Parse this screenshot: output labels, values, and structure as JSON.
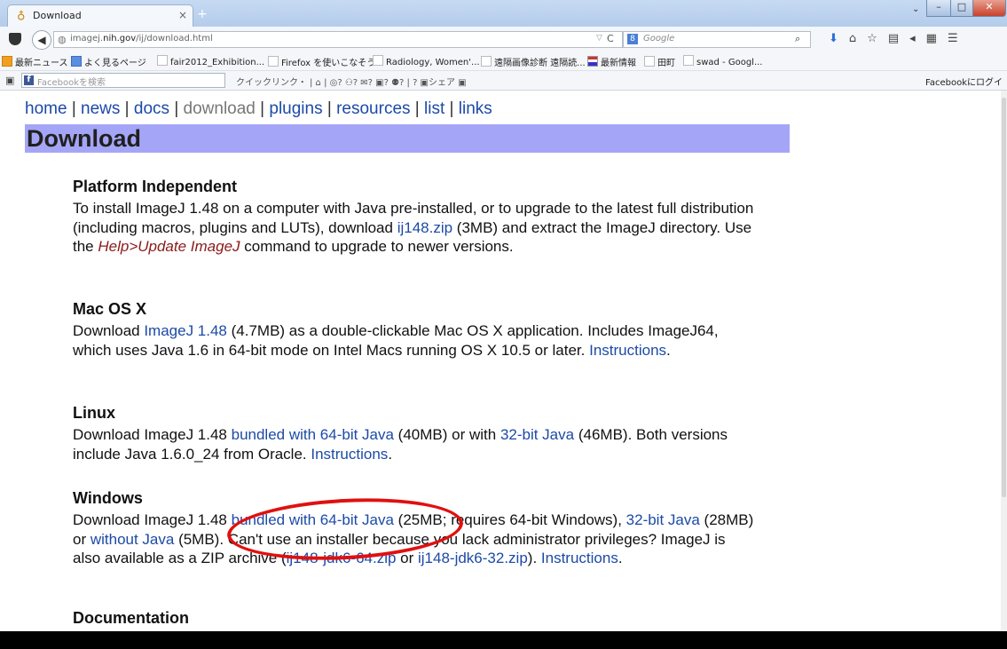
{
  "browser": {
    "tab_title": "Download",
    "url_prefix": "imagej.",
    "url_domain": "nih.gov",
    "url_path": "/ij/download.html",
    "search_engine": "8",
    "search_placeholder": "Google",
    "bookmarks": [
      {
        "label": "最新ニュース",
        "icon": "news-icon"
      },
      {
        "label": "よく見るページ",
        "icon": "blue-icon"
      },
      {
        "label": "fair2012_Exhibition...",
        "icon": "page-icon"
      },
      {
        "label": "Firefox を使いこなそう",
        "icon": "page-icon"
      },
      {
        "label": "Radiology, Women'...",
        "icon": "page-icon"
      },
      {
        "label": "遠隔画像診断 遠隔読...",
        "icon": "page-icon"
      },
      {
        "label": "最新情報",
        "icon": "flag-icon"
      },
      {
        "label": "田町",
        "icon": "page-icon"
      },
      {
        "label": "swad - Googl...",
        "icon": "page-icon"
      }
    ],
    "fb_search_placeholder": "Facebookを検索",
    "fb_quicklinks": "クイックリンク・",
    "fb_share": "シェア",
    "fb_login": "Facebookにログイン"
  },
  "page": {
    "nav": {
      "home": "home",
      "news": "news",
      "docs": "docs",
      "download": "download",
      "plugins": "plugins",
      "resources": "resources",
      "list": "list",
      "links": "links",
      "sep": "|"
    },
    "title": "Download",
    "platform": {
      "heading": "Platform Independent",
      "t1": "To install ImageJ 1.48 on a computer with Java pre-installed, or to upgrade to the latest full distribution (including macros, plugins and LUTs), download ",
      "link_zip": "ij148.zip",
      "t2": " (3MB) and extract the ImageJ directory. Use the ",
      "link_help": "Help>Update ImageJ",
      "t3": " command to upgrade to newer versions."
    },
    "mac": {
      "heading": "Mac OS X",
      "t1": "Download ",
      "link_imagej": "ImageJ 1.48",
      "t2": " (4.7MB) as a double-clickable Mac OS X application. Includes ImageJ64, which uses Java 1.6 in 64-bit mode on Intel Macs running OS X 10.5 or later. ",
      "link_instructions": "Instructions",
      "t3": "."
    },
    "linux": {
      "heading": "Linux",
      "t1": "Download ImageJ 1.48 ",
      "link_64": "bundled with 64-bit Java",
      "t2": " (40MB) or with ",
      "link_32": "32-bit Java",
      "t3": " (46MB). Both versions include Java 1.6.0_24 from Oracle. ",
      "link_instructions": "Instructions",
      "t4": "."
    },
    "windows": {
      "heading": "Windows",
      "t1": "Download ImageJ 1.48 ",
      "link_64": "bundled with 64-bit Java",
      "t2": " (25MB; requires 64-bit Windows), ",
      "link_32": "32-bit Java",
      "t3": " (28MB) or ",
      "link_without": "without Java",
      "t4": " (5MB). Can't use an installer because you lack administrator privileges? ImageJ is also available as a ZIP archive (",
      "link_zip64": "ij148-jdk6-64.zip",
      "t5": " or ",
      "link_zip32": "ij148-jdk6-32.zip",
      "t6": "). ",
      "link_instructions": "Instructions",
      "t7": "."
    },
    "documentation": {
      "heading": "Documentation"
    }
  },
  "colors": {
    "link": "#1c4aa8",
    "banner": "#a5a5f7",
    "annotation": "#e01010"
  }
}
